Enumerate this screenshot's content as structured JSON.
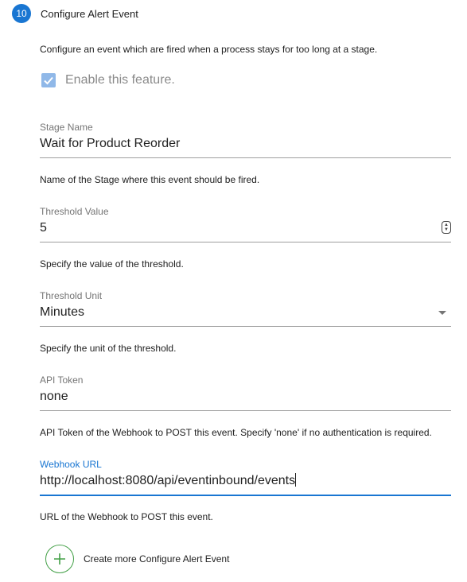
{
  "step": {
    "number": "10",
    "title": "Configure Alert Event"
  },
  "intro": "Configure an event which are fired when a process stays for too long at a stage.",
  "enable_feature": {
    "label": "Enable this feature.",
    "checked": true
  },
  "fields": {
    "stage_name": {
      "label": "Stage Name",
      "value": "Wait for Product Reorder",
      "helper": "Name of the Stage where this event should be fired."
    },
    "threshold_value": {
      "label": "Threshold Value",
      "value": "5",
      "helper": "Specify the value of the threshold."
    },
    "threshold_unit": {
      "label": "Threshold Unit",
      "value": "Minutes",
      "helper": "Specify the unit of the threshold."
    },
    "api_token": {
      "label": "API Token",
      "value": "none",
      "helper": "API Token of the Webhook to POST this event. Specify 'none' if no authentication is required."
    },
    "webhook_url": {
      "label": "Webhook URL",
      "value": "http://localhost:8080/api/eventinbound/events",
      "helper": "URL of the Webhook to POST this event."
    }
  },
  "add_more": {
    "label": "Create more Configure Alert Event",
    "icon": "plus-circle-icon"
  },
  "colors": {
    "accent": "#1976d2",
    "add_icon": "#43a047",
    "checkbox": "#90b8e8"
  }
}
